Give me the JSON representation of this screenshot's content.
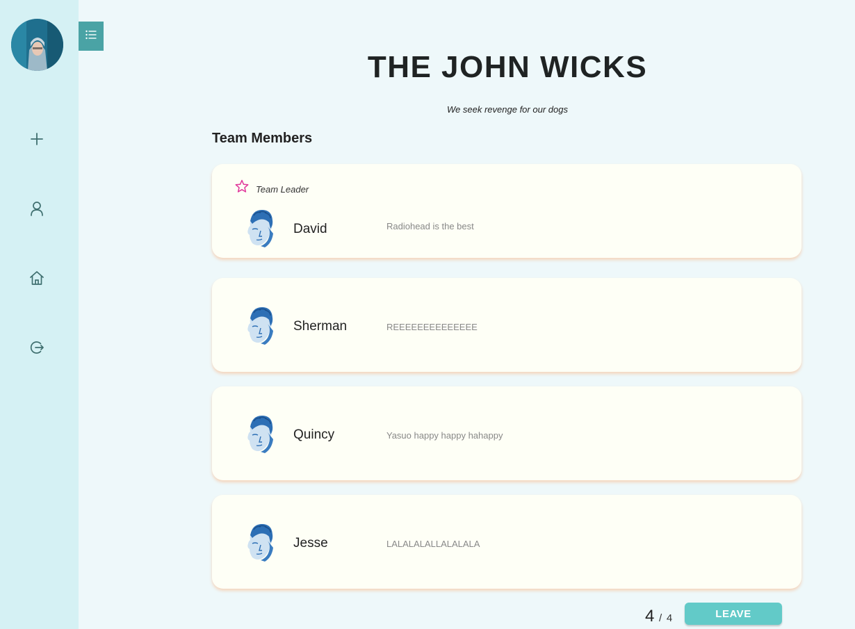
{
  "sidebar": {
    "nav": [
      {
        "icon": "plus-icon"
      },
      {
        "icon": "user-icon"
      },
      {
        "icon": "home-icon"
      },
      {
        "icon": "logout-icon"
      }
    ]
  },
  "team": {
    "name": "THE JOHN WICKS",
    "motto": "We seek revenge for our dogs"
  },
  "members_heading": "Team Members",
  "leader_label": "Team Leader",
  "members": [
    {
      "name": "David",
      "bio": "Radiohead is the best",
      "leader": true
    },
    {
      "name": "Sherman",
      "bio": "REEEEEEEEEEEEEE",
      "leader": false
    },
    {
      "name": "Quincy",
      "bio": "Yasuo happy happy hahappy",
      "leader": false
    },
    {
      "name": "Jesse",
      "bio": "LALALALALLALALALA",
      "leader": false
    }
  ],
  "footer": {
    "count": "4",
    "separator": "/",
    "max": "4",
    "leave_label": "LEAVE"
  },
  "colors": {
    "sidebar_bg": "#d5f1f4",
    "page_bg": "#eef8fa",
    "card_bg": "#fefff6",
    "accent_teal": "#62cac8",
    "toggle_teal": "#4aa3a5",
    "leader_star": "#e0359a"
  }
}
